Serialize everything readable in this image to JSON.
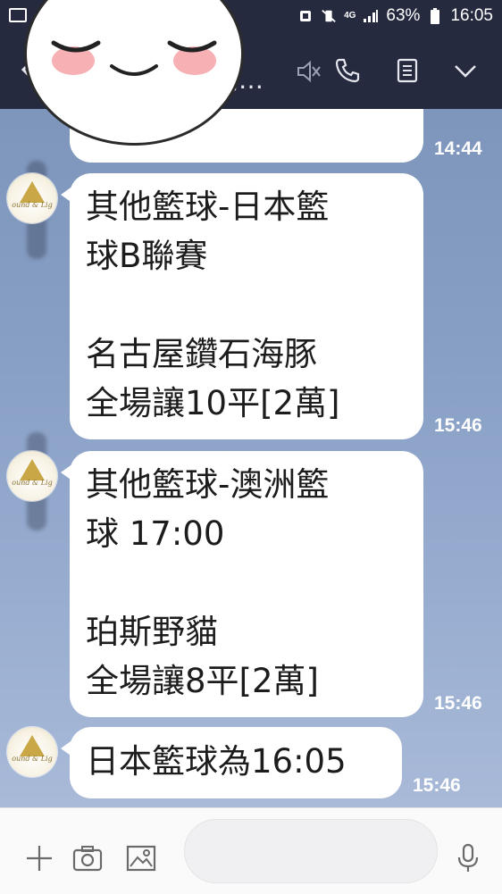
{
  "status_bar": {
    "network": "4G",
    "battery": "63%",
    "time": "16:05"
  },
  "header": {
    "title_partial": "端…"
  },
  "messages": [
    {
      "text": "",
      "time": "14:44"
    },
    {
      "text": "其他籃球-日本籃\n球B聯賽\n\n名古屋鑽石海豚\n全場讓10平[2萬]",
      "time": "15:46"
    },
    {
      "text": "其他籃球-澳洲籃\n球 17:00\n\n珀斯野貓\n全場讓8平[2萬]",
      "time": "15:46"
    },
    {
      "text": "日本籃球為16:05",
      "time": "15:46"
    }
  ],
  "avatar_logo_text": "ound & Lig",
  "icons": {
    "back": "back-arrow-icon",
    "mute": "mute-icon",
    "call": "phone-icon",
    "notes": "notes-icon",
    "dropdown": "chevron-down-icon",
    "add": "plus-icon",
    "camera": "camera-icon",
    "gallery": "image-icon",
    "emoji": "emoji-icon",
    "voice": "microphone-icon"
  }
}
